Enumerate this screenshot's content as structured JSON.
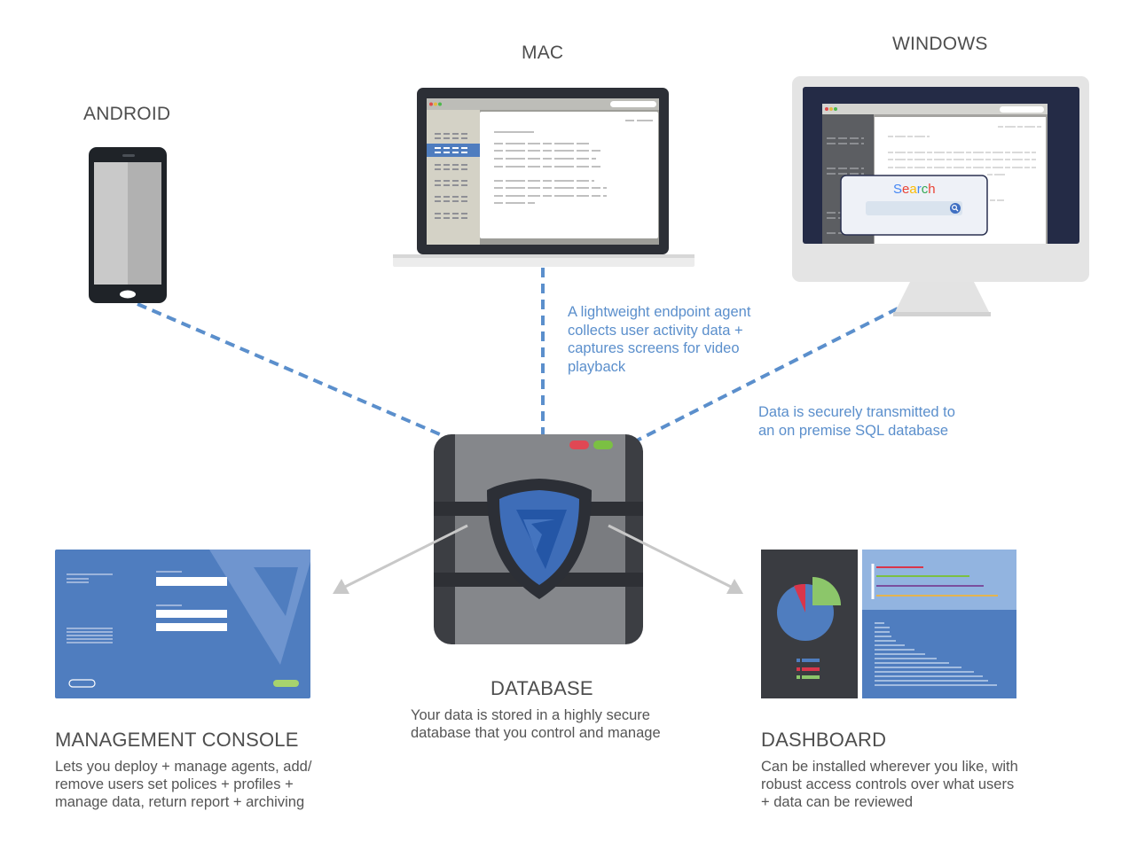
{
  "devices": {
    "android": {
      "label": "ANDROID"
    },
    "mac": {
      "label": "MAC"
    },
    "windows": {
      "label": "WINDOWS",
      "search_label": "Search"
    }
  },
  "annotations": {
    "agent_note": "A lightweight endpoint agent\ncollects user activity data +\ncaptures screens for video\nplayback",
    "transmit_note": "Data is securely transmitted to\nan on premise SQL database"
  },
  "database": {
    "title": "DATABASE",
    "description": "Your data is stored in a highly secure\ndatabase that you control and manage"
  },
  "management_console": {
    "title": "MANAGEMENT CONSOLE",
    "description": "Lets you deploy + manage agents, add/\nremove users set polices + profiles +\nmanage data, return report + archiving"
  },
  "dashboard": {
    "title": "DASHBOARD",
    "description": "Can be installed wherever you like, with\nrobust access controls over what  users\n+ data can be reviewed"
  },
  "colors": {
    "brand_blue": "#4f7dbf",
    "dash_blue": "#5b8fcc",
    "server_gray": "#7a7c80",
    "device_dark": "#2f3440",
    "pie_red": "#d9364b",
    "pie_green": "#8cc66a"
  },
  "icons": [
    "shield-logo-icon",
    "arrow-left-icon",
    "arrow-right-icon",
    "search-icon"
  ]
}
